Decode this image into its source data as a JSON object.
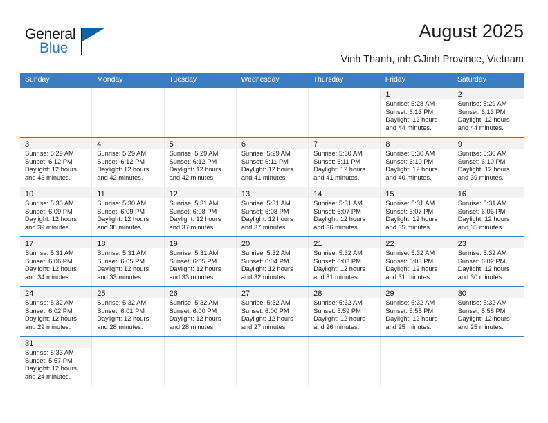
{
  "brand": {
    "name_top": "General",
    "name_bottom": "Blue",
    "accent_color": "#2b7cc4",
    "flag_color": "#1362a6"
  },
  "header": {
    "title": "August 2025",
    "subtitle": "Vinh Thanh, inh GJinh Province, Vietnam"
  },
  "theme": {
    "header_bar": "#3b7dbf",
    "daynum_band": "#f2f2f2",
    "row_rule": "#3b7dbf"
  },
  "weekdays": [
    "Sunday",
    "Monday",
    "Tuesday",
    "Wednesday",
    "Thursday",
    "Friday",
    "Saturday"
  ],
  "weeks": [
    [
      {
        "day": "",
        "empty": true
      },
      {
        "day": "",
        "empty": true
      },
      {
        "day": "",
        "empty": true
      },
      {
        "day": "",
        "empty": true
      },
      {
        "day": "",
        "empty": true
      },
      {
        "day": "1",
        "sunrise": "Sunrise: 5:28 AM",
        "sunset": "Sunset: 6:13 PM",
        "daylight1": "Daylight: 12 hours",
        "daylight2": "and 44 minutes."
      },
      {
        "day": "2",
        "sunrise": "Sunrise: 5:29 AM",
        "sunset": "Sunset: 6:13 PM",
        "daylight1": "Daylight: 12 hours",
        "daylight2": "and 44 minutes."
      }
    ],
    [
      {
        "day": "3",
        "sunrise": "Sunrise: 5:29 AM",
        "sunset": "Sunset: 6:12 PM",
        "daylight1": "Daylight: 12 hours",
        "daylight2": "and 43 minutes."
      },
      {
        "day": "4",
        "sunrise": "Sunrise: 5:29 AM",
        "sunset": "Sunset: 6:12 PM",
        "daylight1": "Daylight: 12 hours",
        "daylight2": "and 42 minutes."
      },
      {
        "day": "5",
        "sunrise": "Sunrise: 5:29 AM",
        "sunset": "Sunset: 6:12 PM",
        "daylight1": "Daylight: 12 hours",
        "daylight2": "and 42 minutes."
      },
      {
        "day": "6",
        "sunrise": "Sunrise: 5:29 AM",
        "sunset": "Sunset: 6:11 PM",
        "daylight1": "Daylight: 12 hours",
        "daylight2": "and 41 minutes."
      },
      {
        "day": "7",
        "sunrise": "Sunrise: 5:30 AM",
        "sunset": "Sunset: 6:11 PM",
        "daylight1": "Daylight: 12 hours",
        "daylight2": "and 41 minutes."
      },
      {
        "day": "8",
        "sunrise": "Sunrise: 5:30 AM",
        "sunset": "Sunset: 6:10 PM",
        "daylight1": "Daylight: 12 hours",
        "daylight2": "and 40 minutes."
      },
      {
        "day": "9",
        "sunrise": "Sunrise: 5:30 AM",
        "sunset": "Sunset: 6:10 PM",
        "daylight1": "Daylight: 12 hours",
        "daylight2": "and 39 minutes."
      }
    ],
    [
      {
        "day": "10",
        "sunrise": "Sunrise: 5:30 AM",
        "sunset": "Sunset: 6:09 PM",
        "daylight1": "Daylight: 12 hours",
        "daylight2": "and 39 minutes."
      },
      {
        "day": "11",
        "sunrise": "Sunrise: 5:30 AM",
        "sunset": "Sunset: 6:09 PM",
        "daylight1": "Daylight: 12 hours",
        "daylight2": "and 38 minutes."
      },
      {
        "day": "12",
        "sunrise": "Sunrise: 5:31 AM",
        "sunset": "Sunset: 6:08 PM",
        "daylight1": "Daylight: 12 hours",
        "daylight2": "and 37 minutes."
      },
      {
        "day": "13",
        "sunrise": "Sunrise: 5:31 AM",
        "sunset": "Sunset: 6:08 PM",
        "daylight1": "Daylight: 12 hours",
        "daylight2": "and 37 minutes."
      },
      {
        "day": "14",
        "sunrise": "Sunrise: 5:31 AM",
        "sunset": "Sunset: 6:07 PM",
        "daylight1": "Daylight: 12 hours",
        "daylight2": "and 36 minutes."
      },
      {
        "day": "15",
        "sunrise": "Sunrise: 5:31 AM",
        "sunset": "Sunset: 6:07 PM",
        "daylight1": "Daylight: 12 hours",
        "daylight2": "and 35 minutes."
      },
      {
        "day": "16",
        "sunrise": "Sunrise: 5:31 AM",
        "sunset": "Sunset: 6:06 PM",
        "daylight1": "Daylight: 12 hours",
        "daylight2": "and 35 minutes."
      }
    ],
    [
      {
        "day": "17",
        "sunrise": "Sunrise: 5:31 AM",
        "sunset": "Sunset: 6:06 PM",
        "daylight1": "Daylight: 12 hours",
        "daylight2": "and 34 minutes."
      },
      {
        "day": "18",
        "sunrise": "Sunrise: 5:31 AM",
        "sunset": "Sunset: 6:05 PM",
        "daylight1": "Daylight: 12 hours",
        "daylight2": "and 33 minutes."
      },
      {
        "day": "19",
        "sunrise": "Sunrise: 5:31 AM",
        "sunset": "Sunset: 6:05 PM",
        "daylight1": "Daylight: 12 hours",
        "daylight2": "and 33 minutes."
      },
      {
        "day": "20",
        "sunrise": "Sunrise: 5:32 AM",
        "sunset": "Sunset: 6:04 PM",
        "daylight1": "Daylight: 12 hours",
        "daylight2": "and 32 minutes."
      },
      {
        "day": "21",
        "sunrise": "Sunrise: 5:32 AM",
        "sunset": "Sunset: 6:03 PM",
        "daylight1": "Daylight: 12 hours",
        "daylight2": "and 31 minutes."
      },
      {
        "day": "22",
        "sunrise": "Sunrise: 5:32 AM",
        "sunset": "Sunset: 6:03 PM",
        "daylight1": "Daylight: 12 hours",
        "daylight2": "and 31 minutes."
      },
      {
        "day": "23",
        "sunrise": "Sunrise: 5:32 AM",
        "sunset": "Sunset: 6:02 PM",
        "daylight1": "Daylight: 12 hours",
        "daylight2": "and 30 minutes."
      }
    ],
    [
      {
        "day": "24",
        "sunrise": "Sunrise: 5:32 AM",
        "sunset": "Sunset: 6:02 PM",
        "daylight1": "Daylight: 12 hours",
        "daylight2": "and 29 minutes."
      },
      {
        "day": "25",
        "sunrise": "Sunrise: 5:32 AM",
        "sunset": "Sunset: 6:01 PM",
        "daylight1": "Daylight: 12 hours",
        "daylight2": "and 28 minutes."
      },
      {
        "day": "26",
        "sunrise": "Sunrise: 5:32 AM",
        "sunset": "Sunset: 6:00 PM",
        "daylight1": "Daylight: 12 hours",
        "daylight2": "and 28 minutes."
      },
      {
        "day": "27",
        "sunrise": "Sunrise: 5:32 AM",
        "sunset": "Sunset: 6:00 PM",
        "daylight1": "Daylight: 12 hours",
        "daylight2": "and 27 minutes."
      },
      {
        "day": "28",
        "sunrise": "Sunrise: 5:32 AM",
        "sunset": "Sunset: 5:59 PM",
        "daylight1": "Daylight: 12 hours",
        "daylight2": "and 26 minutes."
      },
      {
        "day": "29",
        "sunrise": "Sunrise: 5:32 AM",
        "sunset": "Sunset: 5:58 PM",
        "daylight1": "Daylight: 12 hours",
        "daylight2": "and 25 minutes."
      },
      {
        "day": "30",
        "sunrise": "Sunrise: 5:32 AM",
        "sunset": "Sunset: 5:58 PM",
        "daylight1": "Daylight: 12 hours",
        "daylight2": "and 25 minutes."
      }
    ],
    [
      {
        "day": "31",
        "sunrise": "Sunrise: 5:33 AM",
        "sunset": "Sunset: 5:57 PM",
        "daylight1": "Daylight: 12 hours",
        "daylight2": "and 24 minutes."
      },
      {
        "day": "",
        "empty": true
      },
      {
        "day": "",
        "empty": true
      },
      {
        "day": "",
        "empty": true
      },
      {
        "day": "",
        "empty": true
      },
      {
        "day": "",
        "empty": true
      },
      {
        "day": "",
        "empty": true
      }
    ]
  ]
}
